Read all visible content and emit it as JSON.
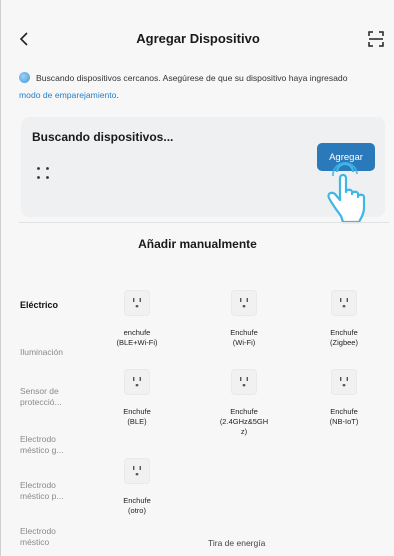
{
  "header": {
    "title": "Agregar Dispositivo"
  },
  "info": {
    "text": "Buscando dispositivos cercanos. Asegúrese de que su dispositivo haya ingresado",
    "link": "modo de emparejamiento",
    "link_suffix": "."
  },
  "search": {
    "title": "Buscando dispositivos...",
    "add_label": "Agregar"
  },
  "manual": {
    "title": "Añadir manualmente"
  },
  "sidebar": {
    "items": [
      {
        "label": "Eléctrico"
      },
      {
        "label": "Iluminación"
      },
      {
        "label": "Sensor de\nprotecció..."
      },
      {
        "label": "Electrodo\nméstico g..."
      },
      {
        "label": "Electrodo\nméstico p..."
      },
      {
        "label": "Electrodo\nméstico"
      }
    ]
  },
  "devices": [
    {
      "label": "enchufe\n(BLE+Wi-Fi)"
    },
    {
      "label": "Enchufe\n(Wi-Fi)"
    },
    {
      "label": "Enchufe\n(Zigbee)"
    },
    {
      "label": "Enchufe\n(BLE)"
    },
    {
      "label": "Enchufe\n(2.4GHz&5GH\nz)"
    },
    {
      "label": "Enchufe\n(NB-IoT)"
    },
    {
      "label": "Enchufe\n(otro)"
    }
  ],
  "bottom": {
    "next_label": "Tira de energía"
  },
  "colors": {
    "accent": "#2a79bb",
    "link": "#2a7ec3",
    "hand": "#3fb6e6"
  }
}
